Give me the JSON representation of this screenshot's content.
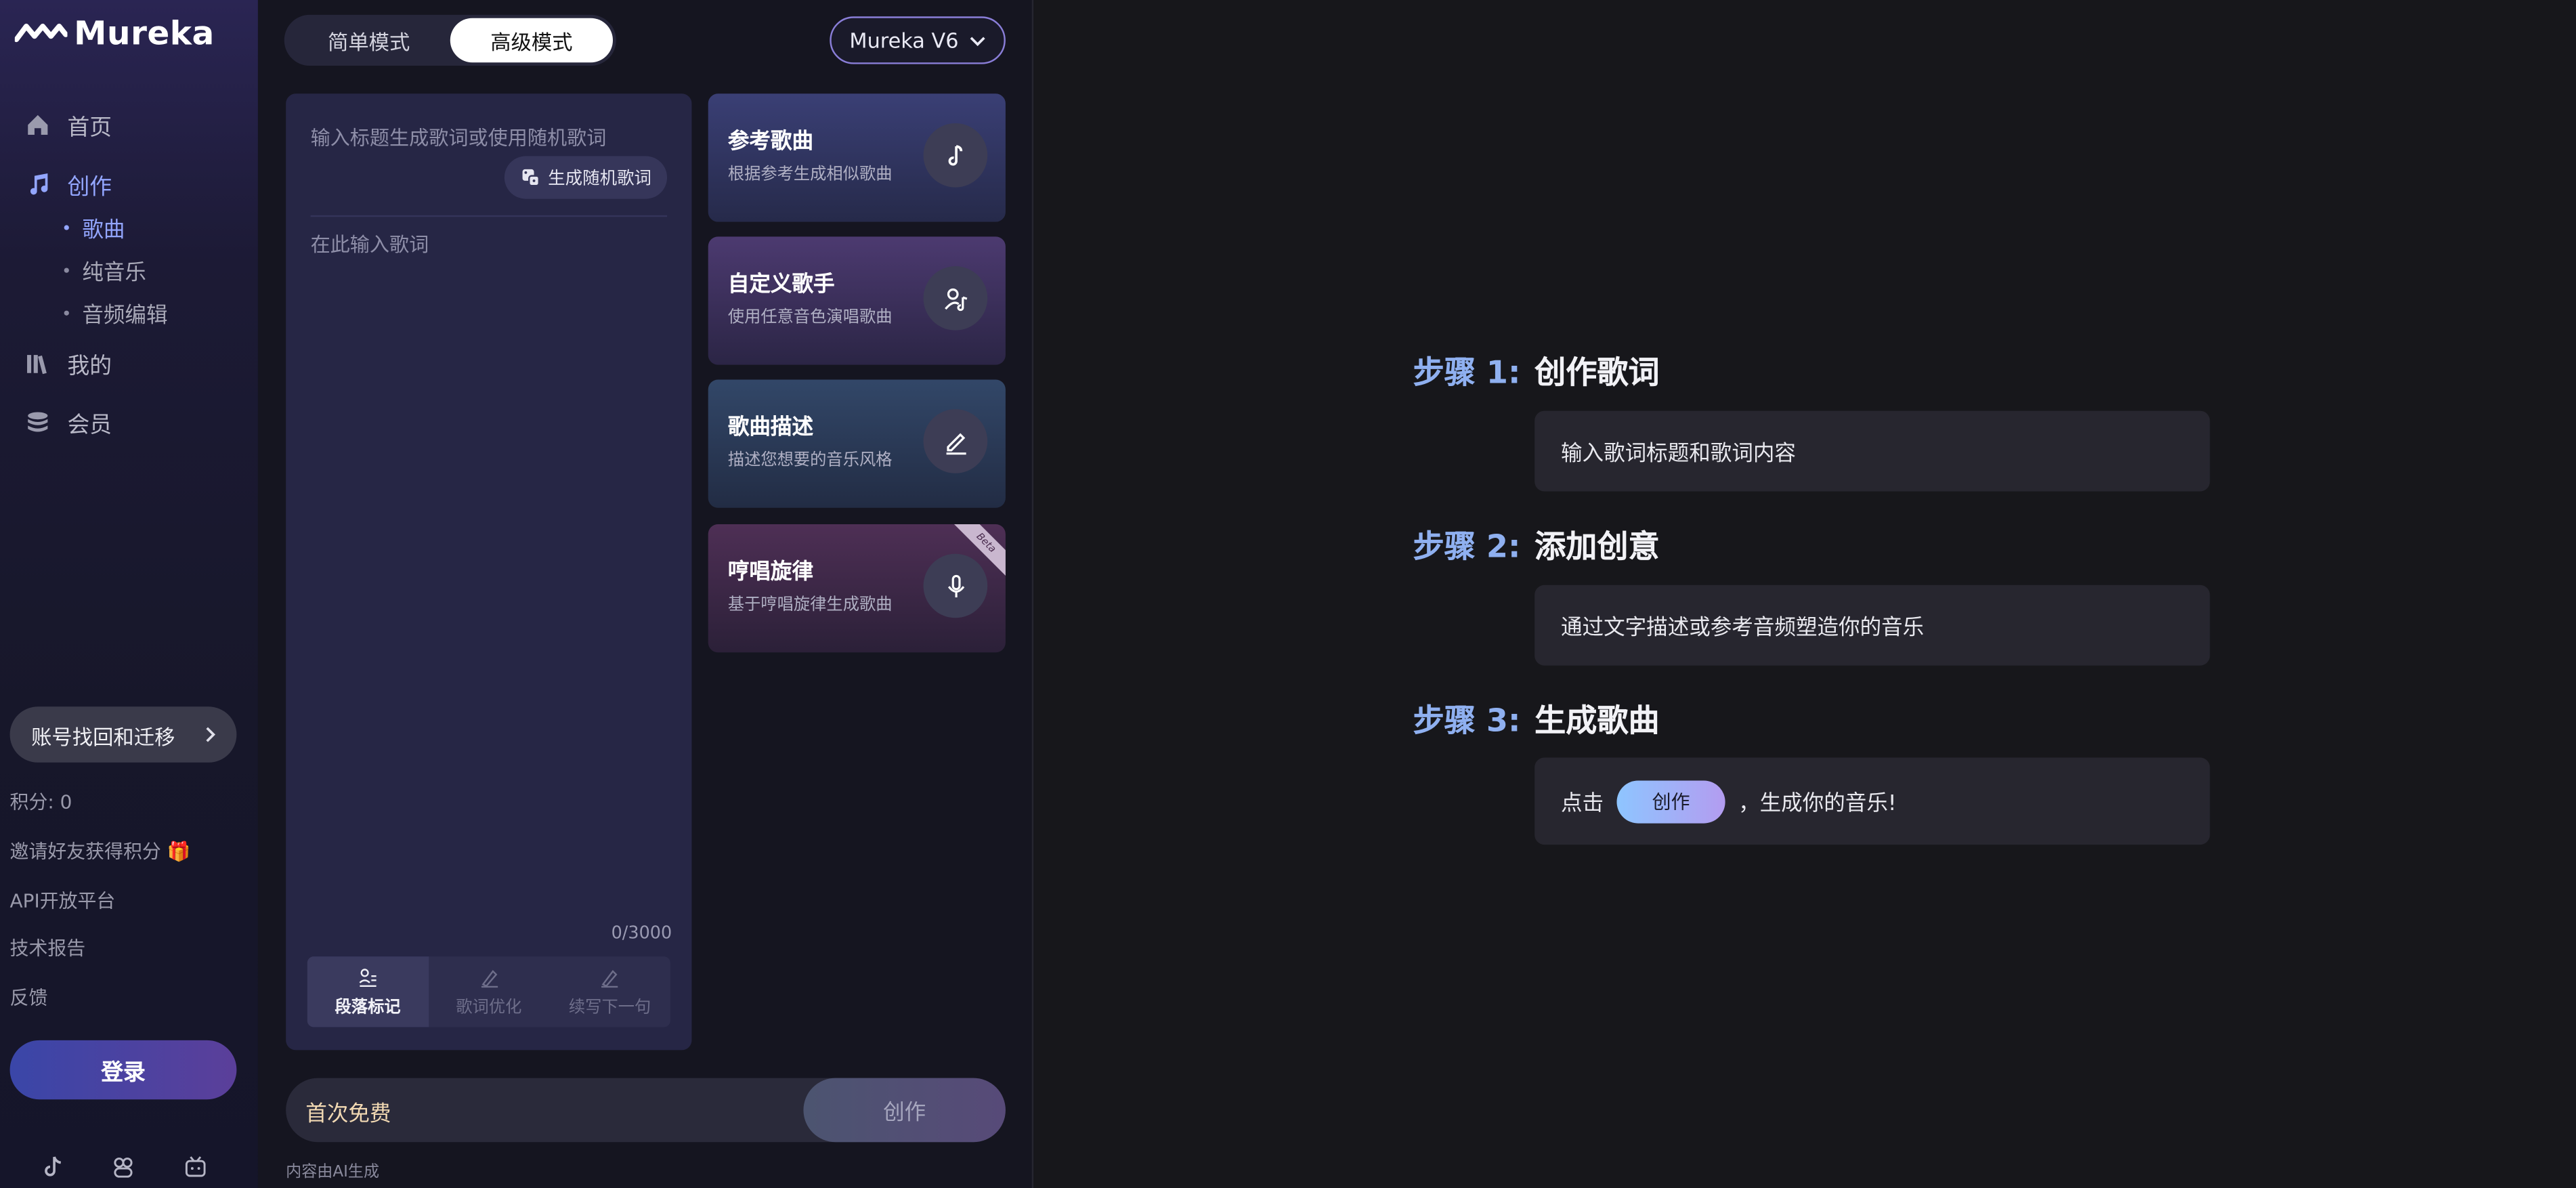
{
  "colors": {
    "accent": "#93a6ff",
    "step_number": "#8fb0f0",
    "free_label": "#f2d9b3",
    "pill_gradient_start": "#8ec5ff",
    "pill_gradient_end": "#b39cf0"
  },
  "app": {
    "name": "Mureka"
  },
  "sidebar": {
    "nav": [
      {
        "label": "首页",
        "icon": "home-icon"
      },
      {
        "label": "创作",
        "icon": "music-note-icon"
      },
      {
        "label": "我的",
        "icon": "library-icon"
      },
      {
        "label": "会员",
        "icon": "coins-icon"
      }
    ],
    "create_sub": [
      {
        "label": "歌曲"
      },
      {
        "label": "纯音乐"
      },
      {
        "label": "音频编辑"
      }
    ],
    "recover_label": "账号找回和迁移",
    "points": "积分: 0",
    "invite": "邀请好友获得积分 🎁",
    "api": "API开放平台",
    "tech_report": "技术报告",
    "feedback": "反馈",
    "login_label": "登录",
    "social_icons": [
      "tiktok-icon",
      "discord-icon",
      "bilibili-icon"
    ]
  },
  "center": {
    "mode_tabs": [
      {
        "label": "简单模式"
      },
      {
        "label": "高级模式"
      }
    ],
    "model_select": {
      "value": "Mureka V6"
    },
    "title_placeholder": "输入标题生成歌词或使用随机歌词",
    "random_lyrics_label": "生成随机歌词",
    "lyrics_placeholder": "在此输入歌词",
    "char_count": "0/3000",
    "tools": [
      {
        "label": "段落标记",
        "icon": "paragraph-mark-icon"
      },
      {
        "label": "歌词优化",
        "icon": "optimize-icon"
      },
      {
        "label": "续写下一句",
        "icon": "continue-write-icon"
      }
    ],
    "cards": [
      {
        "title": "参考歌曲",
        "subtitle": "根据参考生成相似歌曲",
        "icon": "music-note-icon"
      },
      {
        "title": "自定义歌手",
        "subtitle": "使用任意音色演唱歌曲",
        "icon": "singer-icon"
      },
      {
        "title": "歌曲描述",
        "subtitle": "描述您想要的音乐风格",
        "icon": "pencil-icon"
      },
      {
        "title": "哼唱旋律",
        "subtitle": "基于哼唱旋律生成歌曲",
        "icon": "microphone-icon",
        "badge": "Beta"
      }
    ],
    "free_label": "首次免费",
    "create_label": "创作",
    "ai_note": "内容由AI生成"
  },
  "steps": [
    {
      "number": "步骤 1:",
      "title": "创作歌词",
      "text": "输入歌词标题和歌词内容"
    },
    {
      "number": "步骤 2:",
      "title": "添加创意",
      "text": "通过文字描述或参考音频塑造你的音乐"
    },
    {
      "number": "步骤 3:",
      "title": "生成歌曲",
      "prefix": "点击",
      "pill": "创作",
      "suffix": "，生成你的音乐!"
    }
  ]
}
